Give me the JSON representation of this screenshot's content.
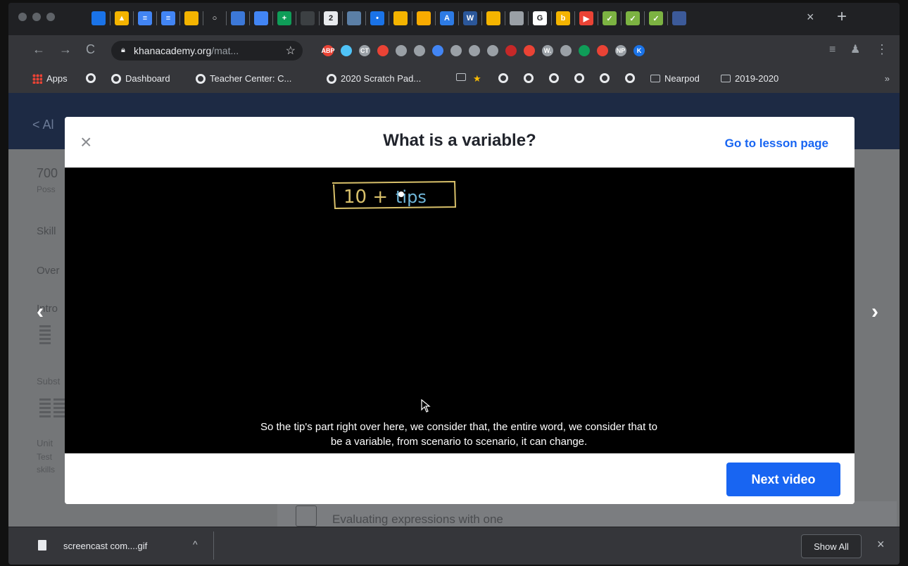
{
  "browser": {
    "tab_close": "×",
    "new_tab": "+",
    "tab_icons": [
      {
        "icon": "classroom-icon",
        "color": "#1a73e8",
        "glyph": ""
      },
      {
        "icon": "drive-icon",
        "color": "#f4b400",
        "glyph": "▲"
      },
      {
        "icon": "docs-icon",
        "color": "#4285f4",
        "glyph": "≡"
      },
      {
        "icon": "docs-icon",
        "color": "#4285f4",
        "glyph": "≡"
      },
      {
        "icon": "slides-icon",
        "color": "#f4b400",
        "glyph": ""
      },
      {
        "icon": "circle-icon",
        "color": "#202124",
        "glyph": "○"
      },
      {
        "icon": "forms-icon",
        "color": "#3c78d8",
        "glyph": ""
      },
      {
        "icon": "calendar-icon",
        "color": "#4285f4",
        "glyph": ""
      },
      {
        "icon": "sheets-icon",
        "color": "#0f9d58",
        "glyph": "+"
      },
      {
        "icon": "dim-tab-icon",
        "color": "#3c4043",
        "glyph": ""
      },
      {
        "icon": "number-two-icon",
        "color": "#e8eaed",
        "glyph": "2"
      },
      {
        "icon": "photo-icon",
        "color": "#5b7fa6",
        "glyph": ""
      },
      {
        "icon": "dot-icon",
        "color": "#1a73e8",
        "glyph": "•"
      },
      {
        "icon": "yellow-icon",
        "color": "#f4b400",
        "glyph": ""
      },
      {
        "icon": "doc-badge-icon",
        "color": "#f9ab00",
        "glyph": ""
      },
      {
        "icon": "appstore-icon",
        "color": "#2d7be5",
        "glyph": "A"
      },
      {
        "icon": "word-icon",
        "color": "#2b579a",
        "glyph": "W"
      },
      {
        "icon": "bulb-icon",
        "color": "#f4b400",
        "glyph": ""
      },
      {
        "icon": "newspaper-icon",
        "color": "#9aa0a6",
        "glyph": ""
      },
      {
        "icon": "google-icon",
        "color": "#ffffff",
        "glyph": "G"
      },
      {
        "icon": "b-icon",
        "color": "#f4b400",
        "glyph": "b"
      },
      {
        "icon": "play-icon",
        "color": "#ea4335",
        "glyph": "▶"
      },
      {
        "icon": "check-icon",
        "color": "#7cb342",
        "glyph": "✓"
      },
      {
        "icon": "check-icon",
        "color": "#7cb342",
        "glyph": "✓"
      },
      {
        "icon": "check-icon",
        "color": "#7cb342",
        "glyph": "✓"
      },
      {
        "icon": "usa-icon",
        "color": "#3c5a99",
        "glyph": ""
      }
    ],
    "url_host": "khanacademy.org",
    "url_path": "/mat...",
    "extensions": [
      "#ea4335",
      "#4fc3f7",
      "#9aa0a6",
      "#ea4335",
      "#9aa0a6",
      "#9aa0a6",
      "#4285f4",
      "#9aa0a6",
      "#9aa0a6",
      "#9aa0a6",
      "#c62828",
      "#ea4335",
      "#9aa0a6",
      "#9aa0a6",
      "#0f9d58",
      "#ea4335",
      "#9aa0a6",
      "#1a73e8"
    ],
    "ext_labels": [
      "ABP",
      "",
      "CT",
      "",
      "",
      "",
      "",
      "",
      "",
      "",
      "",
      "",
      "W.",
      "",
      "",
      "",
      "NP",
      "K"
    ],
    "bookmarks": [
      {
        "kind": "apps",
        "label": "Apps"
      },
      {
        "kind": "globe",
        "label": ""
      },
      {
        "kind": "globe",
        "label": "Dashboard"
      },
      {
        "kind": "globe",
        "label": "Teacher Center: C..."
      },
      {
        "kind": "globe",
        "label": "2020 Scratch Pad..."
      },
      {
        "kind": "folder",
        "label": ""
      },
      {
        "kind": "star",
        "label": ""
      },
      {
        "kind": "globe",
        "label": ""
      },
      {
        "kind": "globe",
        "label": ""
      },
      {
        "kind": "globe",
        "label": ""
      },
      {
        "kind": "globe",
        "label": ""
      },
      {
        "kind": "globe",
        "label": ""
      },
      {
        "kind": "globe",
        "label": ""
      },
      {
        "kind": "folder",
        "label": "Nearpod"
      },
      {
        "kind": "folder",
        "label": "2019-2020"
      }
    ],
    "bookmarks_more": "»"
  },
  "page": {
    "back_label": "< Al",
    "score": "700",
    "score_sub": "Poss",
    "skill": "Skill",
    "over": "Over",
    "intro": "Intro",
    "subst": "Subst",
    "unit": "Unit",
    "unit_sub1": "Test",
    "unit_sub2": "skills",
    "lesson_item": "Evaluating expressions with one"
  },
  "modal": {
    "close_label": "×",
    "title": "What is a variable?",
    "lesson_link": "Go to lesson page",
    "whiteboard_text": "10 + tips",
    "caption_line1": "So the tip's part right over here, we consider that, the entire word, we consider that to",
    "caption_line2": "be a variable, from scenario to scenario, it can change.",
    "next_label": "Next video",
    "prev_arrow": "‹",
    "next_arrow": "›"
  },
  "downloads": {
    "file_name": "screencast com....gif",
    "chevron": "^",
    "show_all": "Show All",
    "close": "×"
  },
  "colors": {
    "accent": "#1865f2",
    "chalk_yellow": "#d8c06a",
    "chalk_blue": "#6fb6d8"
  }
}
